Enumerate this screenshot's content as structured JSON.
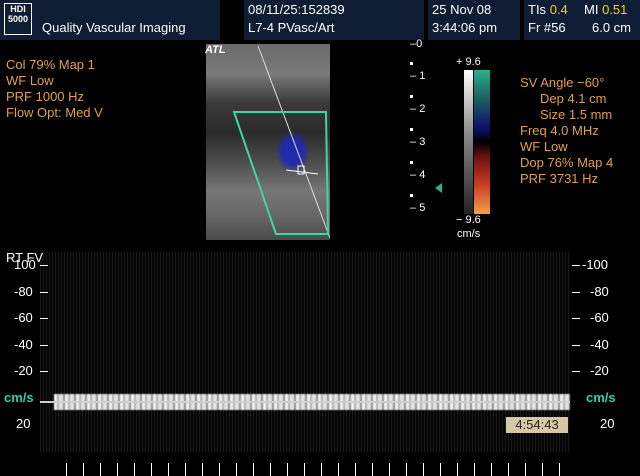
{
  "header": {
    "logo_line1": "HDI",
    "logo_line2": "5000",
    "institution": "Quality Vascular Imaging",
    "patient_id": "08/11/25:152839",
    "probe": "L7-4 PVasc/Art",
    "date": "25 Nov 08",
    "time": "3:44:06 pm",
    "tis_label": "TIs",
    "tis_value": "0.4",
    "mi_label": "MI",
    "mi_value": "0.51",
    "frame": "Fr #56",
    "depth": "6.0 cm"
  },
  "left_params": [
    "Col 79%  Map 1",
    "WF Low",
    "PRF 1000  Hz",
    "Flow Opt: Med V"
  ],
  "image": {
    "atl_label": "ATL",
    "depth_marks": [
      "0",
      "1",
      "2",
      "3",
      "4",
      "5"
    ]
  },
  "colorbar": {
    "top": "+ 9.6",
    "bottom": "− 9.6",
    "unit": "cm/s"
  },
  "right_params": [
    "SV Angle −60°",
    "Dep 4.1  cm",
    "Size 1.5  mm",
    "Freq 4.0  MHz",
    "WF Low",
    "Dop 76%  Map 4",
    "PRF 3731  Hz"
  ],
  "spectrum": {
    "label": "RT  FV",
    "scale_left": [
      "100",
      "-80",
      "-60",
      "-40",
      "-20"
    ],
    "scale_right": [
      "-100",
      "-80",
      "-60",
      "-40",
      "-20"
    ],
    "unit": "cm/s",
    "below": "20",
    "timer": "4:54:43"
  },
  "colors": {
    "header_bg": "#0e1d33",
    "param_text": "#e0a050",
    "highlight": "#f0d419",
    "sample_box": "#3ad8a0",
    "unit_text": "#2ad0b0"
  }
}
